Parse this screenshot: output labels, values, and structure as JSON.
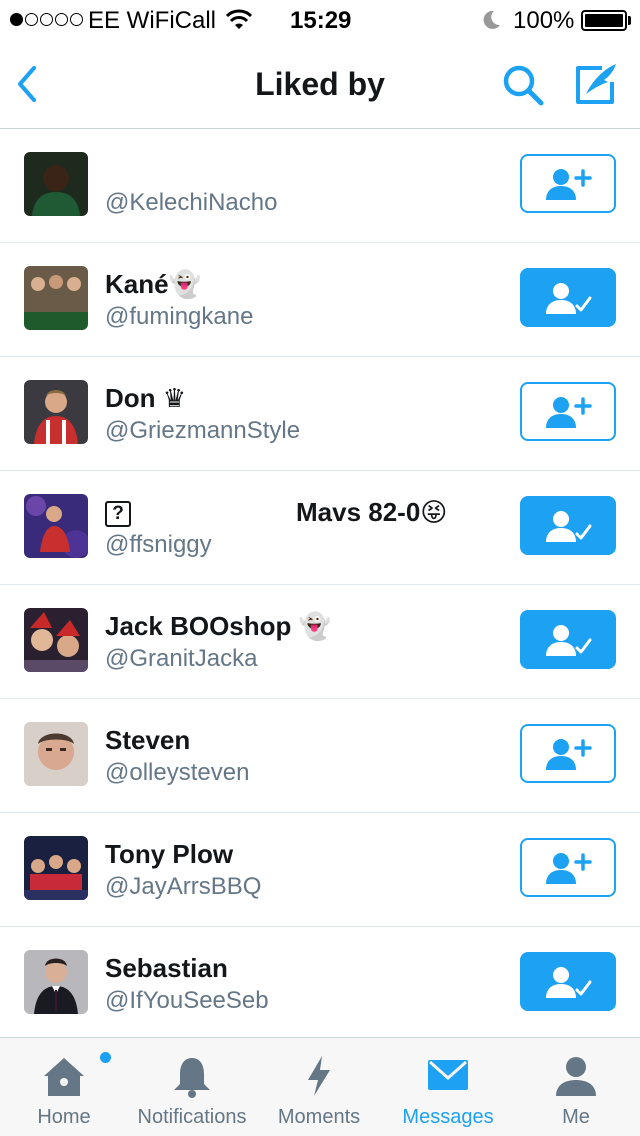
{
  "status_bar": {
    "carrier": "EE WiFiCall",
    "time": "15:29",
    "battery": "100%"
  },
  "nav": {
    "title": "Liked by"
  },
  "users": [
    {
      "name": "",
      "handle": "@KelechiNacho",
      "following": false,
      "avatar_color": "#2c3a2a"
    },
    {
      "name": "Kané👻",
      "handle": "@fumingkane",
      "following": true,
      "avatar_color": "#5a6b4a"
    },
    {
      "name": "Don ♛",
      "handle": "@GriezmannStyle",
      "following": false,
      "avatar_color": "#b8323a"
    },
    {
      "name": "",
      "handle": "@ffsniggy",
      "following": true,
      "avatar_color": "#3b2a7a",
      "name_box": "?",
      "name_extra": "Mavs 82-0😝"
    },
    {
      "name": "Jack BOOshop 👻",
      "handle": "@GranitJacka",
      "following": true,
      "avatar_color": "#7a2a3a"
    },
    {
      "name": "Steven",
      "handle": "@olleysteven",
      "following": false,
      "avatar_color": "#c8a890"
    },
    {
      "name": "Tony Plow",
      "handle": "@JayArrsBBQ",
      "following": false,
      "avatar_color": "#2a3050"
    },
    {
      "name": "Sebastian",
      "handle": "@IfYouSeeSeb",
      "following": true,
      "avatar_color": "#6a6a70"
    }
  ],
  "tabs": [
    {
      "label": "Home",
      "icon": "home-icon",
      "active": false
    },
    {
      "label": "Notifications",
      "icon": "bell-icon",
      "active": false
    },
    {
      "label": "Moments",
      "icon": "lightning-icon",
      "active": false
    },
    {
      "label": "Messages",
      "icon": "envelope-icon",
      "active": true
    },
    {
      "label": "Me",
      "icon": "person-icon",
      "active": false
    }
  ],
  "colors": {
    "accent": "#1da1f2",
    "text": "#14171a",
    "muted": "#657786"
  }
}
